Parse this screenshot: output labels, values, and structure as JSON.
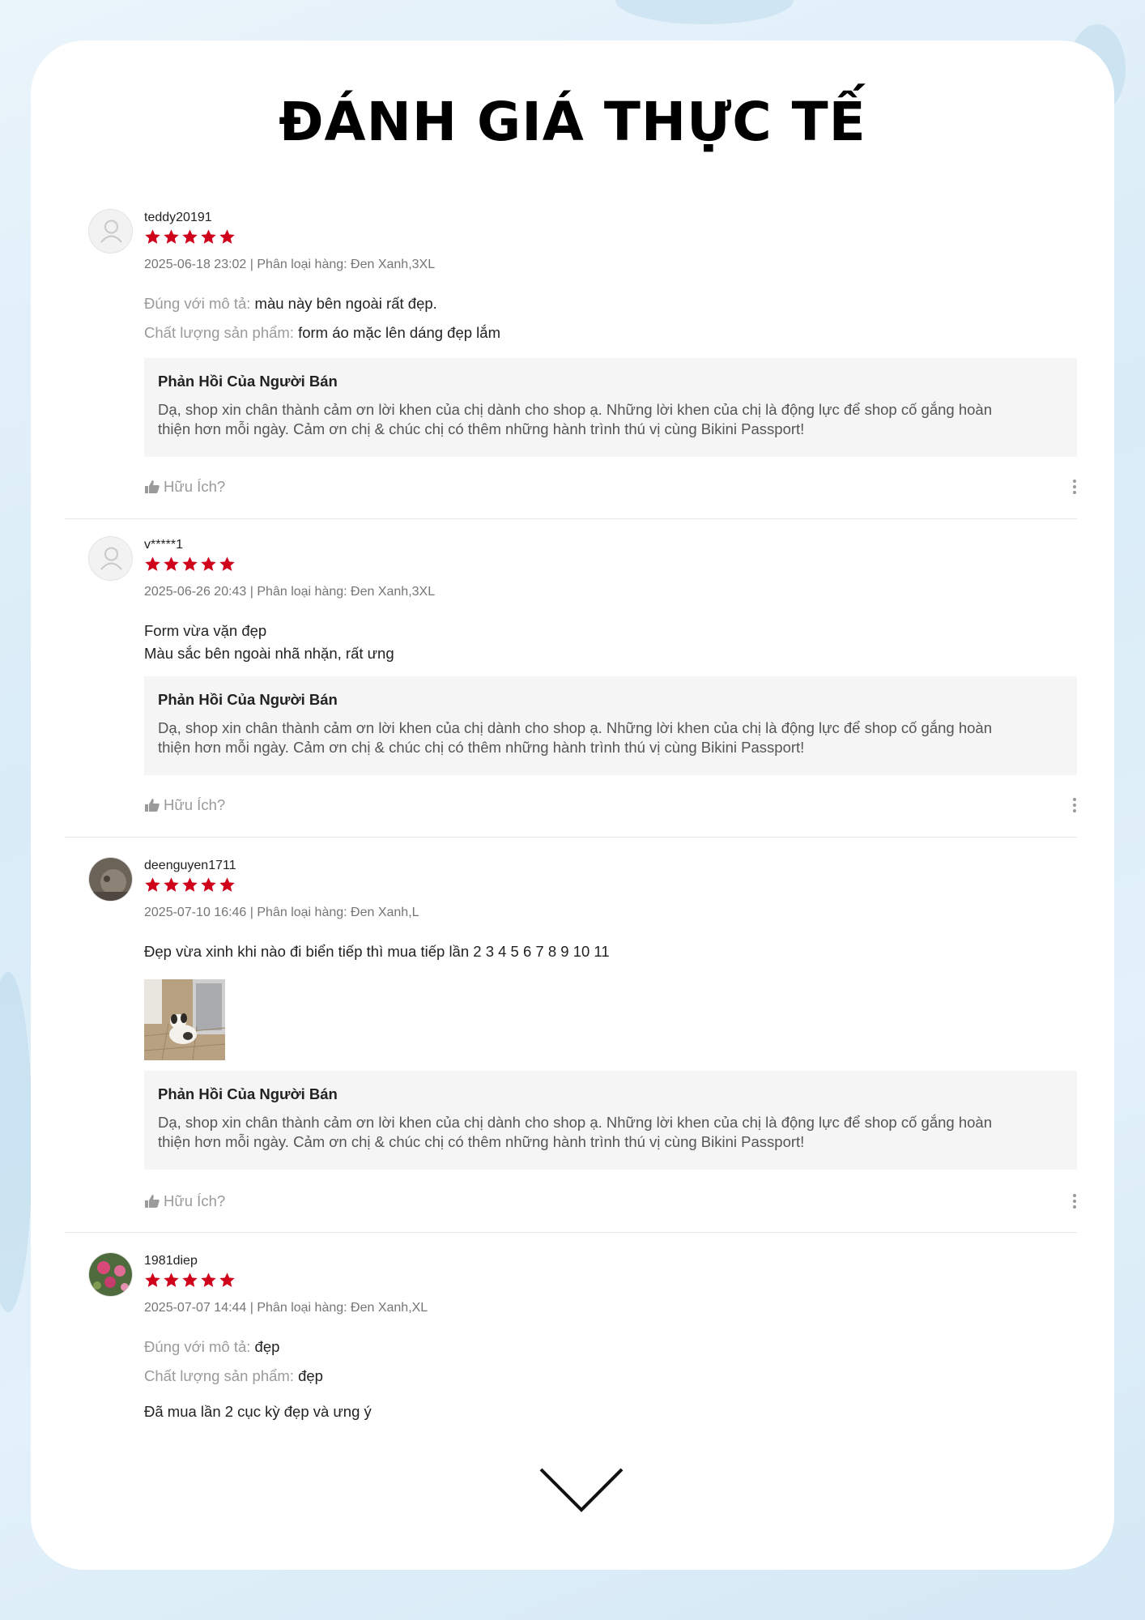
{
  "title": "ĐÁNH GIÁ THỰC TẾ",
  "colors": {
    "star": "#d0011b",
    "accent_bg": "#d8ebf7"
  },
  "reviews": [
    {
      "user": "teddy20191",
      "rating": 5,
      "meta": "2025-06-18 23:02 | Phân loại hàng: Đen Xanh,3XL",
      "avatar": "default-user-icon",
      "lines": [
        {
          "label": "Đúng với mô tả:",
          "text": "màu này bên ngoài rất đẹp."
        },
        {
          "label": "Chất lượng sản phẩm:",
          "text": "form áo mặc lên dáng đẹp lắm"
        }
      ],
      "reply_title": "Phản Hồi Của Người Bán",
      "reply_line1": "Dạ, shop xin chân thành cảm ơn lời khen của chị dành cho shop ạ. Những lời khen của chị là động lực để shop cố gắng hoàn",
      "reply_line2": "thiện hơn mỗi ngày. Cảm ơn chị & chúc chị có thêm những hành trình thú vị cùng Bikini Passport!",
      "helpful": "Hữu Ích?"
    },
    {
      "user": "v*****1",
      "rating": 5,
      "meta": "2025-06-26 20:43 | Phân loại hàng: Đen Xanh,3XL",
      "avatar": "default-user-icon",
      "lines": [
        {
          "label": "",
          "text": "Form vừa vặn đẹp"
        },
        {
          "label": "",
          "text": "Màu sắc bên ngoài nhã nhặn, rất ưng"
        }
      ],
      "reply_title": "Phản Hồi Của Người Bán",
      "reply_line1": "Dạ, shop xin chân thành cảm ơn lời khen của chị dành cho shop ạ. Những lời khen của chị là động lực để shop cố gắng hoàn",
      "reply_line2": "thiện hơn mỗi ngày. Cảm ơn chị & chúc chị có thêm những hành trình thú vị cùng Bikini Passport!",
      "helpful": "Hữu Ích?"
    },
    {
      "user": "deenguyen1711",
      "rating": 5,
      "meta": "2025-07-10 16:46 | Phân loại hàng: Đen Xanh,L",
      "avatar": "photo-avatar",
      "lines": [
        {
          "label": "",
          "text": "Đẹp vừa xinh khi nào đi biển tiếp thì mua tiếp lần 2 3 4 5 6 7 8 9 10 11"
        }
      ],
      "photo": "dog-photo",
      "reply_title": "Phản Hồi Của Người Bán",
      "reply_line1": "Dạ, shop xin chân thành cảm ơn lời khen của chị dành cho shop ạ. Những lời khen của chị là động lực để shop cố gắng hoàn",
      "reply_line2": "thiện hơn mỗi ngày. Cảm ơn chị & chúc chị có thêm những hành trình thú vị cùng Bikini Passport!",
      "helpful": "Hữu Ích?"
    },
    {
      "user": "1981diep",
      "rating": 5,
      "meta": "2025-07-07 14:44 | Phân loại hàng: Đen Xanh,XL",
      "avatar": "flower-avatar",
      "lines": [
        {
          "label": "Đúng với mô tả:",
          "text": "đẹp"
        },
        {
          "label": "Chất lượng sản phẩm:",
          "text": "đẹp"
        },
        {
          "label": "",
          "text": "Đã mua lần 2 cục kỳ đẹp và ưng ý"
        }
      ]
    }
  ],
  "scroll_hint": "chevron-down-icon"
}
